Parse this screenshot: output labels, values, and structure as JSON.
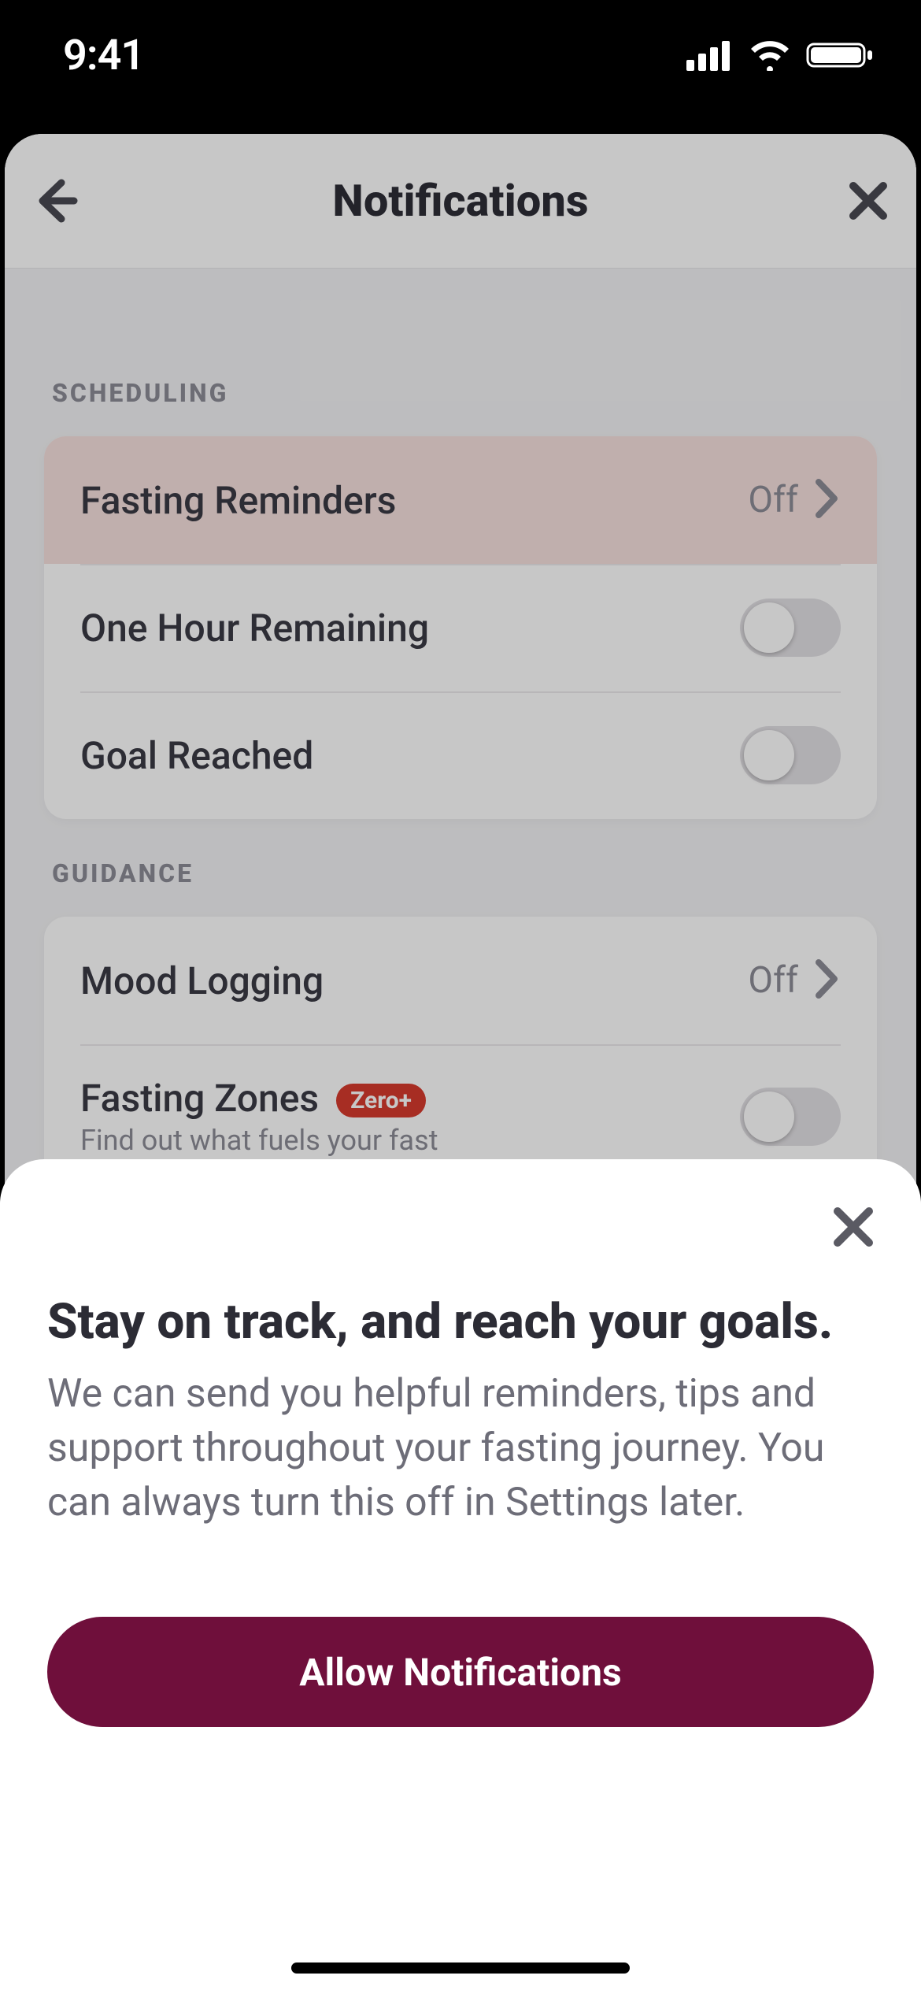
{
  "status": {
    "time": "9:41"
  },
  "header": {
    "title": "Notifications"
  },
  "sections": {
    "scheduling": {
      "title": "SCHEDULING",
      "rows": {
        "fasting_reminders": {
          "label": "Fasting Reminders",
          "value": "Off"
        },
        "one_hour": {
          "label": "One Hour Remaining"
        },
        "goal_reached": {
          "label": "Goal Reached"
        }
      }
    },
    "guidance": {
      "title": "GUIDANCE",
      "rows": {
        "mood_logging": {
          "label": "Mood Logging",
          "value": "Off"
        },
        "fasting_zones": {
          "label": "Fasting Zones",
          "badge": "Zero+",
          "sub": "Find out what fuels your fast"
        }
      }
    }
  },
  "sheet": {
    "title": "Stay on track, and reach your goals.",
    "body": "We can send you helpful reminders, tips and support throughout your fasting journey. You can always turn this off in Settings later.",
    "button_label": "Allow Notifications"
  },
  "colors": {
    "accent": "#6f0f3b",
    "badge_bg": "#d63a2e",
    "highlight_row": "#f6e0de"
  }
}
